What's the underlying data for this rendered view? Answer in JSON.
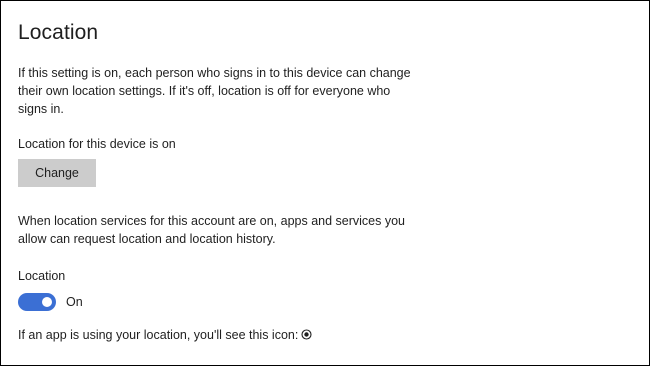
{
  "header": {
    "title": "Location"
  },
  "device_section": {
    "description": "If this setting is on, each person who signs in to this device can change their own location settings. If it's off, location is off for everyone who signs in.",
    "status": "Location for this device is on",
    "change_label": "Change"
  },
  "account_section": {
    "description": "When location services for this account are on, apps and services you allow can request location and location history.",
    "label": "Location",
    "toggle_state": "On",
    "toggle_on": true
  },
  "footer": {
    "text": "If an app is using your location, you'll see this icon:",
    "icon": "location-indicator-icon"
  },
  "colors": {
    "toggle_on": "#3b6fd4",
    "button_bg": "#cccccc",
    "text": "#1f1f1f"
  }
}
